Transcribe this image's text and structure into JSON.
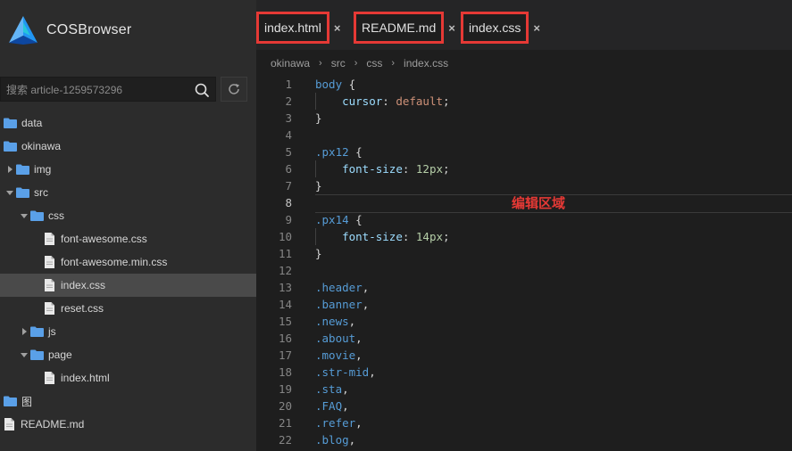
{
  "app": {
    "name": "COSBrowser"
  },
  "search": {
    "placeholder": "搜索 article-1259573296"
  },
  "tree": [
    {
      "label": "data",
      "kind": "folder",
      "depth": 0,
      "caret": "none"
    },
    {
      "label": "okinawa",
      "kind": "folder",
      "depth": 0,
      "caret": "none"
    },
    {
      "label": "img",
      "kind": "folder",
      "depth": 1,
      "caret": "collapsed"
    },
    {
      "label": "src",
      "kind": "folder",
      "depth": 1,
      "caret": "expanded"
    },
    {
      "label": "css",
      "kind": "folder",
      "depth": 2,
      "caret": "expanded"
    },
    {
      "label": "font-awesome.css",
      "kind": "file",
      "depth": 3
    },
    {
      "label": "font-awesome.min.css",
      "kind": "file",
      "depth": 3
    },
    {
      "label": "index.css",
      "kind": "file",
      "depth": 3,
      "selected": true
    },
    {
      "label": "reset.css",
      "kind": "file",
      "depth": 3
    },
    {
      "label": "js",
      "kind": "folder",
      "depth": 2,
      "caret": "collapsed"
    },
    {
      "label": "page",
      "kind": "folder",
      "depth": 2,
      "caret": "expanded"
    },
    {
      "label": "index.html",
      "kind": "file",
      "depth": 3
    },
    {
      "label": "图",
      "kind": "folder",
      "depth": 0,
      "caret": "none"
    },
    {
      "label": "README.md",
      "kind": "file",
      "depth": 0
    }
  ],
  "tabs": [
    {
      "label": "index.html",
      "close": "×"
    },
    {
      "label": "README.md",
      "close": "×"
    },
    {
      "label": "index.css",
      "close": "×"
    }
  ],
  "breadcrumb": [
    "okinawa",
    "src",
    "css",
    "index.css"
  ],
  "breadcrumb_sep": "›",
  "editor": {
    "active_line": 8,
    "annotation": "编辑区域",
    "lines": [
      [
        [
          "body",
          "sel"
        ],
        [
          " {",
          "pun"
        ]
      ],
      [
        [
          "    ",
          "pun"
        ],
        [
          "cursor",
          "prop"
        ],
        [
          ": ",
          "pun"
        ],
        [
          "default",
          "valw"
        ],
        [
          ";",
          "pun"
        ]
      ],
      [
        [
          "}",
          "pun"
        ]
      ],
      [],
      [
        [
          ".px12",
          "sel"
        ],
        [
          " {",
          "pun"
        ]
      ],
      [
        [
          "    ",
          "pun"
        ],
        [
          "font-size",
          "prop"
        ],
        [
          ": ",
          "pun"
        ],
        [
          "12px",
          "num"
        ],
        [
          ";",
          "pun"
        ]
      ],
      [
        [
          "}",
          "pun"
        ]
      ],
      [],
      [
        [
          ".px14",
          "sel"
        ],
        [
          " {",
          "pun"
        ]
      ],
      [
        [
          "    ",
          "pun"
        ],
        [
          "font-size",
          "prop"
        ],
        [
          ": ",
          "pun"
        ],
        [
          "14px",
          "num"
        ],
        [
          ";",
          "pun"
        ]
      ],
      [
        [
          "}",
          "pun"
        ]
      ],
      [],
      [
        [
          ".header",
          "sel"
        ],
        [
          ",",
          "pun"
        ]
      ],
      [
        [
          ".banner",
          "sel"
        ],
        [
          ",",
          "pun"
        ]
      ],
      [
        [
          ".news",
          "sel"
        ],
        [
          ",",
          "pun"
        ]
      ],
      [
        [
          ".about",
          "sel"
        ],
        [
          ",",
          "pun"
        ]
      ],
      [
        [
          ".movie",
          "sel"
        ],
        [
          ",",
          "pun"
        ]
      ],
      [
        [
          ".str-mid",
          "sel"
        ],
        [
          ",",
          "pun"
        ]
      ],
      [
        [
          ".sta",
          "sel"
        ],
        [
          ",",
          "pun"
        ]
      ],
      [
        [
          ".FAQ",
          "sel"
        ],
        [
          ",",
          "pun"
        ]
      ],
      [
        [
          ".refer",
          "sel"
        ],
        [
          ",",
          "pun"
        ]
      ],
      [
        [
          ".blog",
          "sel"
        ],
        [
          ",",
          "pun"
        ]
      ]
    ]
  }
}
